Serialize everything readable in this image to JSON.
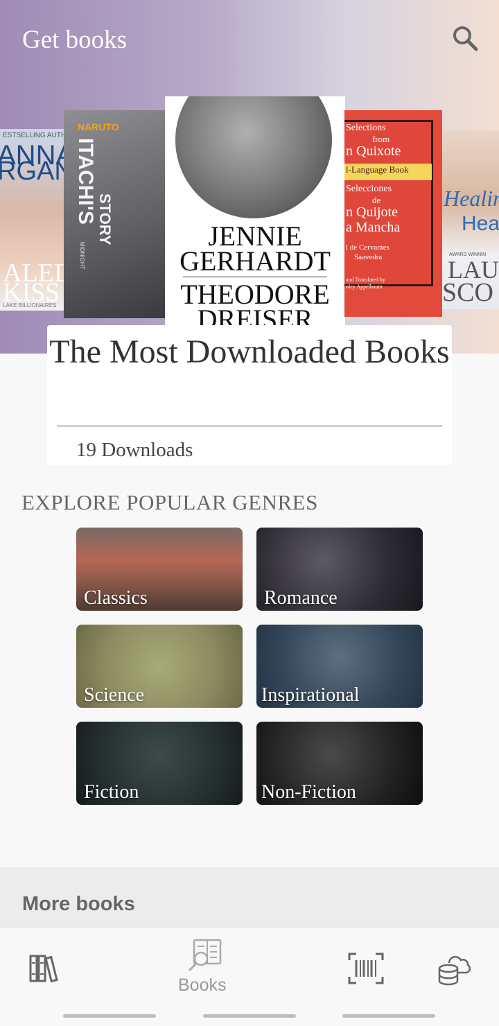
{
  "header": {
    "title": "Get books",
    "search_icon": "search-icon"
  },
  "carousel": {
    "covers": [
      {
        "id": "left2",
        "lines": [
          "ESTSELLING AUTHO",
          "ANNA",
          "RGAN",
          "ALED",
          "KISS",
          "LAKE BILLIONAIRES"
        ]
      },
      {
        "id": "left1",
        "lines": [
          "NARUTO",
          "ITACHI'S",
          "STORY",
          "MIDNIGHT"
        ]
      },
      {
        "id": "main",
        "lines": [
          "JENNIE",
          "GERHARDT",
          "THEODORE",
          "DREISER"
        ]
      },
      {
        "id": "right1",
        "lines": [
          "Selections",
          "from",
          "n Quixote",
          "l-Language Book",
          "Selecciones",
          "de",
          "n Quijote",
          "a Mancha",
          "l de Cervantes",
          "Saavedra",
          "and Translated by",
          "nley Appelbaum"
        ]
      },
      {
        "id": "right2",
        "lines": [
          "Healin",
          "Hea",
          "AWARD WINNIN",
          "LAU",
          "SCO"
        ]
      }
    ]
  },
  "featured": {
    "title": "The Most Downloaded Books",
    "downloads": "19 Downloads"
  },
  "genres": {
    "heading": "EXPLORE POPULAR GENRES",
    "items": [
      {
        "label": "Classics"
      },
      {
        "label": "Romance"
      },
      {
        "label": "Science"
      },
      {
        "label": "Inspirational"
      },
      {
        "label": "Fiction"
      },
      {
        "label": "Non-Fiction"
      }
    ]
  },
  "more": {
    "title": "More books"
  },
  "bottom_nav": {
    "items": [
      {
        "icon": "library-icon",
        "label": ""
      },
      {
        "icon": "books-search-icon",
        "label": "Books"
      },
      {
        "icon": "barcode-scanner-icon",
        "label": ""
      },
      {
        "icon": "cloud-storage-icon",
        "label": ""
      }
    ]
  },
  "colors": {
    "hero_start": "#a08bb6",
    "hero_end": "#f3dfd2",
    "text_dark": "#333333",
    "nav_inactive": "#999999"
  }
}
